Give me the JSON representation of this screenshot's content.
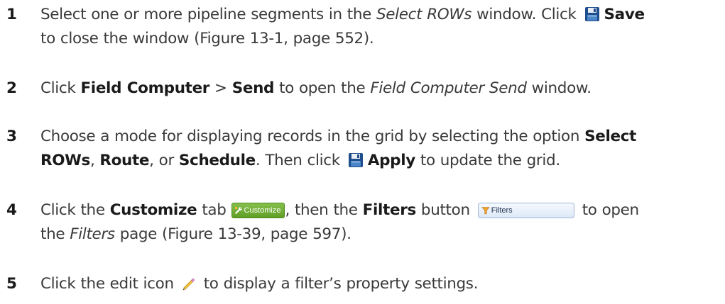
{
  "steps": [
    {
      "number": "1",
      "t1": "Select one or more pipeline segments in the ",
      "t1i": "Select ROWs",
      "t1b": " window. Click ",
      "b1": "Save",
      "t2": "to close the window (Figure 13-1, page 552).",
      "icon": "save-icon"
    },
    {
      "number": "2",
      "t1": "Click ",
      "b1": "Field Computer",
      "t2": " > ",
      "b2": "Send",
      "t3": " to open the ",
      "i1": "Field Computer Send",
      "t4": " window."
    },
    {
      "number": "3",
      "t1": "Choose a mode for displaying records in the grid by selecting the option ",
      "b1": "Select",
      "b2": "ROWs",
      "t2": ", ",
      "b3": "Route",
      "t3": ", or ",
      "b4": "Schedule",
      "t4": ". Then click ",
      "b5": "Apply",
      "t5": " to update the grid.",
      "icon": "save-icon"
    },
    {
      "number": "4",
      "t1": "Click the ",
      "b1": "Customize",
      "t2": " tab ",
      "tab_label": "Customize",
      "t3": ", then the ",
      "b2": "Filters",
      "t4": " button ",
      "button_label": "Filters",
      "t5": " to open",
      "t6": "the ",
      "i1": "Filters",
      "t7": " page (Figure 13-39, page 597)."
    },
    {
      "number": "5",
      "t1": "Click the edit icon ",
      "t2": " to display a filter’s property settings.",
      "icon": "pencil-icon"
    }
  ],
  "colors": {
    "text": "#3a3a3a",
    "customize_tab": "#6aab33",
    "filters_button": "#e6effa",
    "save_icon": "#1f4e8c"
  }
}
